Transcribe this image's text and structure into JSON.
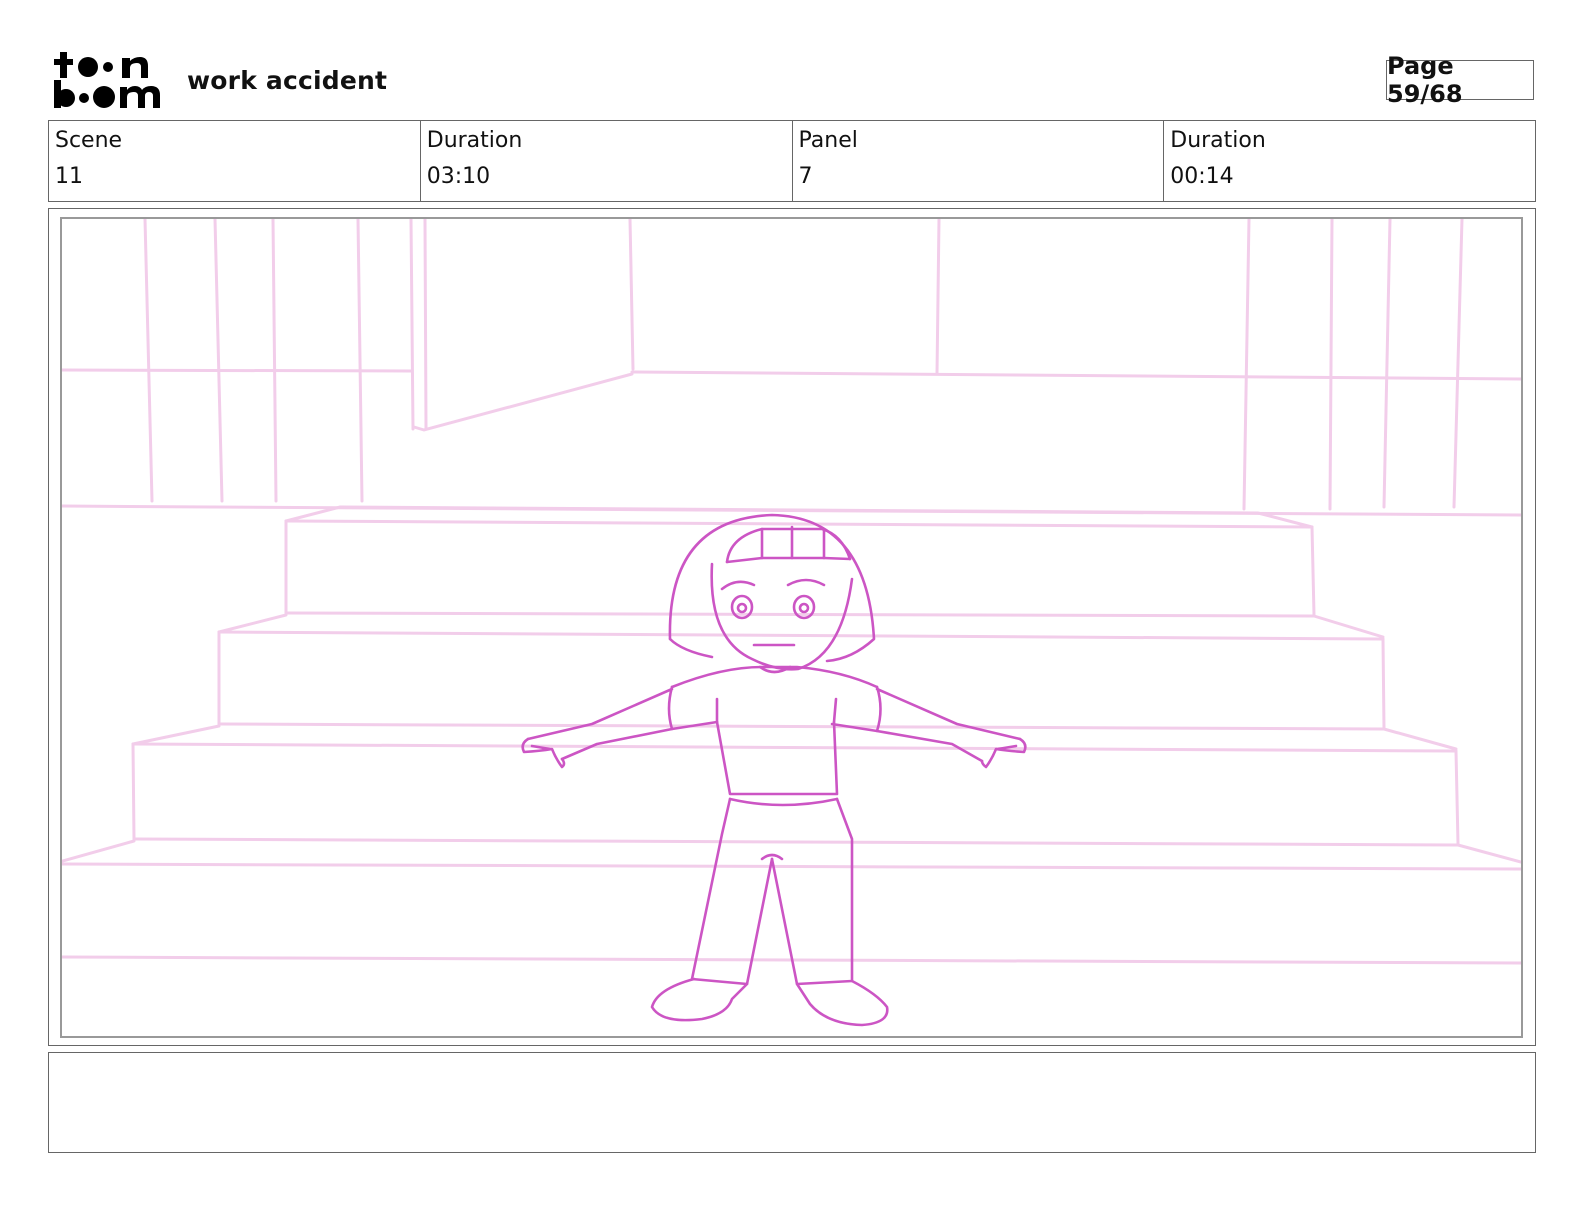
{
  "header": {
    "logo_text": "toonboom",
    "project_title": "work accident",
    "page_indicator": "Page 59/68"
  },
  "info": {
    "scene_label": "Scene",
    "scene_value": "11",
    "scene_duration_label": "Duration",
    "scene_duration_value": "03:10",
    "panel_label": "Panel",
    "panel_value": "7",
    "panel_duration_label": "Duration",
    "panel_duration_value": "00:14"
  },
  "panel": {
    "icon": "storyboard-sketch-image",
    "background_line_color": "#f2cdea",
    "character_line_color": "#cc55c4"
  },
  "notes": {
    "text": ""
  }
}
